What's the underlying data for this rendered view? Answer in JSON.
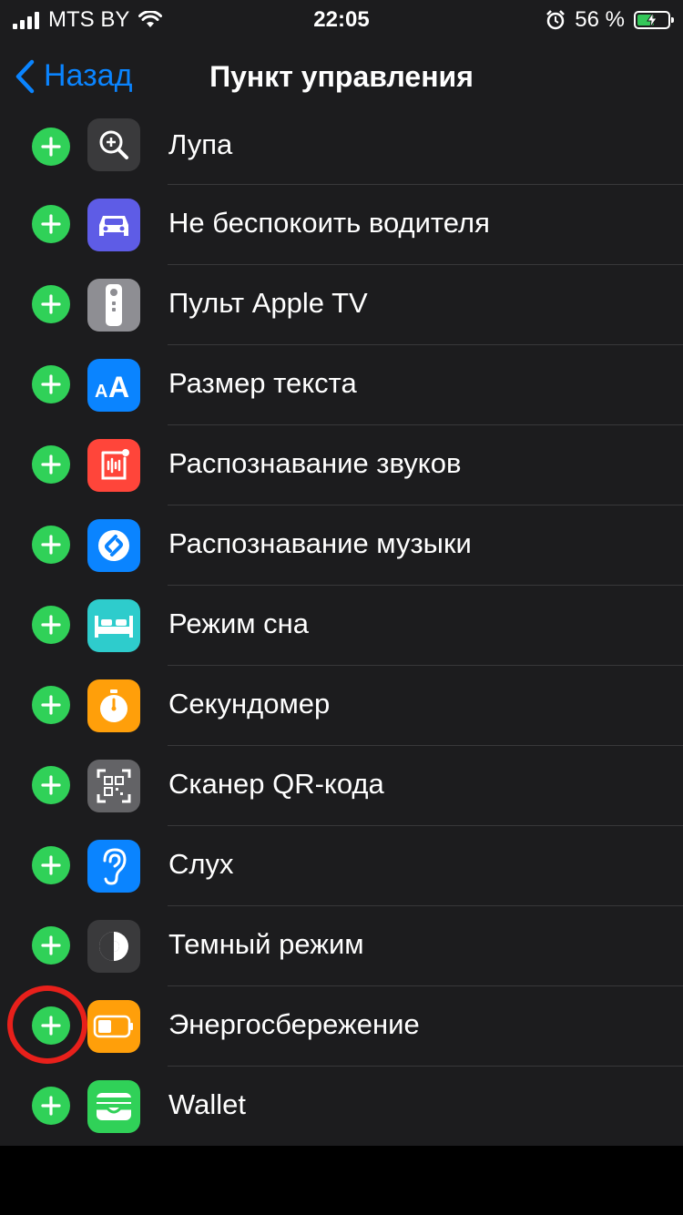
{
  "status_bar": {
    "carrier": "MTS BY",
    "time": "22:05",
    "battery_percent": "56 %",
    "battery_level": 0.56,
    "icons": [
      "signal-icon",
      "wifi-icon",
      "alarm-icon",
      "battery-charging-icon"
    ]
  },
  "nav": {
    "back_label": "Назад",
    "title": "Пункт управления"
  },
  "items": [
    {
      "label": "Лупа",
      "icon": "magnifier-icon",
      "color": "#3a3a3c"
    },
    {
      "label": "Не беспокоить водителя",
      "icon": "car-icon",
      "color": "#5e5ce6"
    },
    {
      "label": "Пульт Apple TV",
      "icon": "remote-icon",
      "color": "#8e8e93"
    },
    {
      "label": "Размер текста",
      "icon": "text-size-icon",
      "color": "#0a84ff"
    },
    {
      "label": "Распознавание звуков",
      "icon": "sound-recognition-icon",
      "color": "#ff453a"
    },
    {
      "label": "Распознавание музыки",
      "icon": "shazam-icon",
      "color": "#0a84ff"
    },
    {
      "label": "Режим сна",
      "icon": "bed-icon",
      "color": "#2ecccc"
    },
    {
      "label": "Секундомер",
      "icon": "stopwatch-icon",
      "color": "#ff9f0a"
    },
    {
      "label": "Сканер QR-кода",
      "icon": "qr-code-icon",
      "color": "#636366"
    },
    {
      "label": "Слух",
      "icon": "ear-icon",
      "color": "#0a84ff"
    },
    {
      "label": "Темный режим",
      "icon": "dark-mode-icon",
      "color": "#3a3a3c"
    },
    {
      "label": "Энергосбережение",
      "icon": "low-power-battery-icon",
      "color": "#ff9f0a"
    },
    {
      "label": "Wallet",
      "icon": "wallet-icon",
      "color": "#30d158"
    }
  ],
  "colors": {
    "accent": "#0a84ff",
    "add_button": "#30d158",
    "highlight": "#e8201b"
  }
}
